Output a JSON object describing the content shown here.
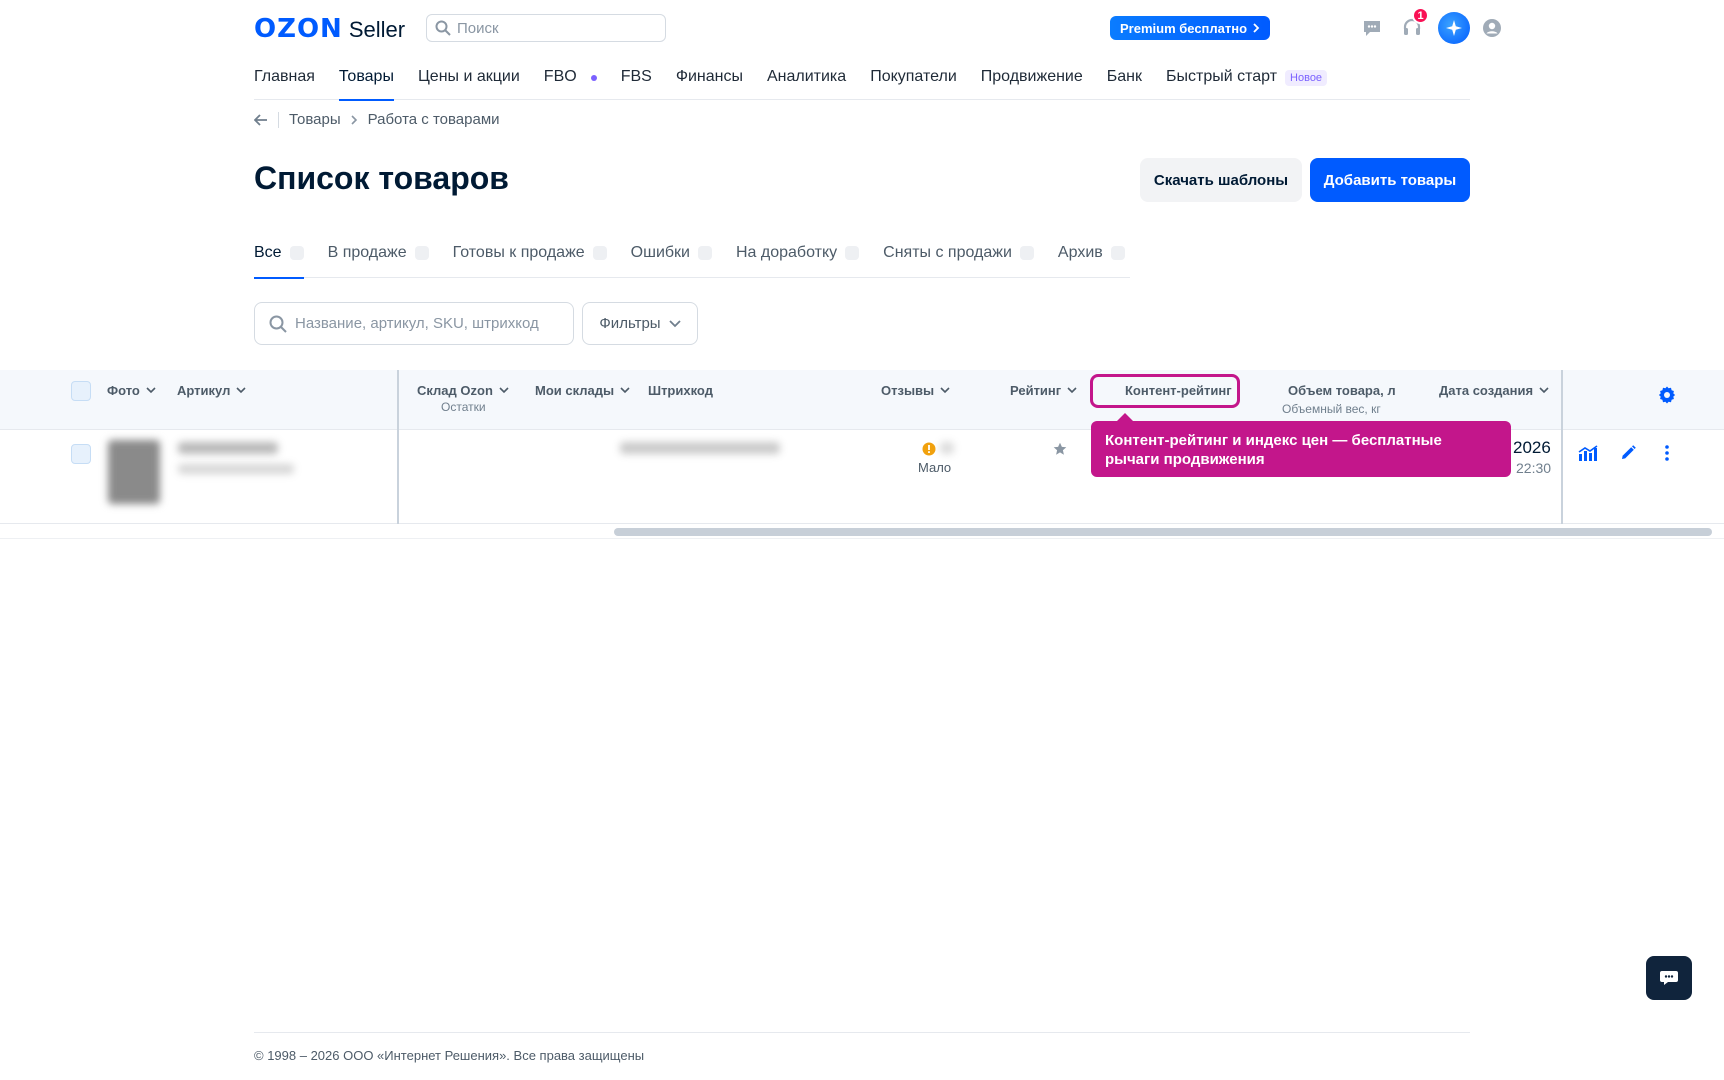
{
  "header": {
    "logo_brand": "OZON",
    "logo_product": "Seller",
    "search_placeholder": "Поиск",
    "premium_label": "Premium бесплатно",
    "support_badge": "1"
  },
  "nav": {
    "items": [
      {
        "label": "Главная"
      },
      {
        "label": "Товары"
      },
      {
        "label": "Цены и акции"
      },
      {
        "label": "FBO"
      },
      {
        "label": "FBS"
      },
      {
        "label": "Финансы"
      },
      {
        "label": "Аналитика"
      },
      {
        "label": "Покупатели"
      },
      {
        "label": "Продвижение"
      },
      {
        "label": "Банк"
      },
      {
        "label": "Быстрый старт"
      }
    ],
    "new_badge": "Новое"
  },
  "breadcrumb": {
    "items": [
      "Товары",
      "Работа с товарами"
    ]
  },
  "page": {
    "title": "Список товаров",
    "download_label": "Скачать шаблоны",
    "add_label": "Добавить товары"
  },
  "tabs": [
    {
      "label": "Все"
    },
    {
      "label": "В продаже"
    },
    {
      "label": "Готовы к продаже"
    },
    {
      "label": "Ошибки"
    },
    {
      "label": "На доработку"
    },
    {
      "label": "Сняты с продажи"
    },
    {
      "label": "Архив"
    }
  ],
  "filters": {
    "search_placeholder": "Название, артикул, SKU, штрихкод",
    "filters_label": "Фильтры"
  },
  "table": {
    "columns": {
      "photo": "Фото",
      "article": "Артикул",
      "ozon_stock": "Склад Ozon",
      "ozon_stock_sub": "Остатки",
      "my_stock": "Мои склады",
      "barcode": "Штрихкод",
      "reviews": "Отзывы",
      "rating": "Рейтинг",
      "content_rating": "Контент-рейтинг",
      "volume": "Объем товара, л",
      "volume_sub": "Объемный вес, кг",
      "created": "Дата создания"
    },
    "row": {
      "reviews_status": "Мало",
      "date_year": "2026",
      "date_time": "22:30"
    }
  },
  "tooltip": {
    "text": "Контент-рейтинг и индекс цен — бесплатные рычаги продвижения"
  },
  "footer": {
    "text": "© 1998 – 2026 ООО «Интернет Решения». Все права защищены"
  },
  "colors": {
    "brand": "#005bff",
    "accent_tooltip": "#c3168b",
    "badge": "#f91155"
  }
}
